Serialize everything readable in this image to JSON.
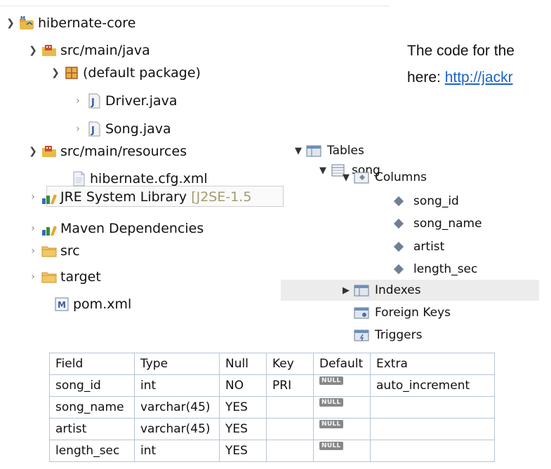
{
  "explorer": {
    "project": "hibernate-core",
    "src_main_java": "src/main/java",
    "default_package": "(default package)",
    "driver_java": "Driver.java",
    "song_java": "Song.java",
    "src_main_resources": "src/main/resources",
    "hibernate_cfg": "hibernate.cfg.xml",
    "jre_library": "JRE System Library",
    "jre_decoration": "[J2SE-1.5",
    "maven_deps": "Maven Dependencies",
    "src": "src",
    "target": "target",
    "pom": "pom.xml"
  },
  "snippet": {
    "line1": "The code for the",
    "line2_prefix": "here: ",
    "link": "http://jackr"
  },
  "schema": {
    "tables": "Tables",
    "table_name": "song",
    "columns": "Columns",
    "column_list": [
      "song_id",
      "song_name",
      "artist",
      "length_sec"
    ],
    "indexes": "Indexes",
    "foreign_keys": "Foreign Keys",
    "triggers": "Triggers"
  },
  "table": {
    "headers": [
      "Field",
      "Type",
      "Null",
      "Key",
      "Default",
      "Extra"
    ],
    "rows": [
      [
        "song_id",
        "int",
        "NO",
        "PRI",
        "NULL",
        "auto_increment"
      ],
      [
        "song_name",
        "varchar(45)",
        "YES",
        "",
        "NULL",
        ""
      ],
      [
        "artist",
        "varchar(45)",
        "YES",
        "",
        "NULL",
        ""
      ],
      [
        "length_sec",
        "int",
        "YES",
        "",
        "NULL",
        ""
      ]
    ]
  },
  "colors": {
    "link": "#1a62c9",
    "grid_border": "#b7c4d6",
    "null_badge": "#888888"
  }
}
